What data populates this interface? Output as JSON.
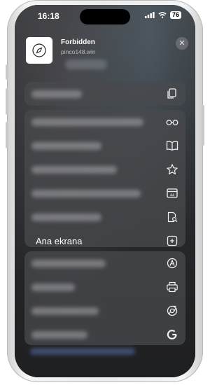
{
  "status_bar": {
    "time": "16:18",
    "battery": "76"
  },
  "header": {
    "title": "Forbidden",
    "url": "pinco148.win",
    "favicon": "compass-icon"
  },
  "menu": {
    "top_group": [
      {
        "icon": "copy-icon",
        "label_hidden": true
      }
    ],
    "middle_group": [
      {
        "icon": "reading-glasses-icon"
      },
      {
        "icon": "book-icon"
      },
      {
        "icon": "star-icon"
      },
      {
        "icon": "tabs-icon"
      },
      {
        "icon": "find-in-page-icon"
      },
      {
        "icon": "add-square-icon",
        "label": "Ana ekrana"
      }
    ],
    "bottom_group": [
      {
        "icon": "compass-a-icon"
      },
      {
        "icon": "printer-icon"
      },
      {
        "icon": "chrome-icon"
      },
      {
        "icon": "google-g-icon"
      }
    ]
  },
  "colors": {
    "panel": "#48494d",
    "text": "#ffffff"
  }
}
